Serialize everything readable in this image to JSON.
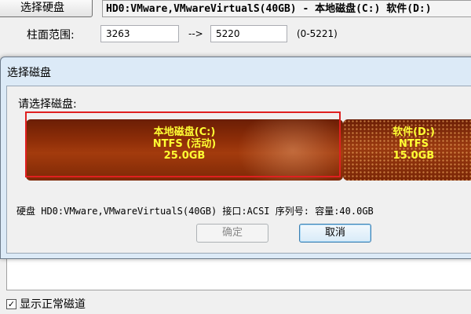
{
  "toolbar": {
    "select_disk_label": "选择硬盘",
    "disk_field_value": "HD0:VMware,VMwareVirtualS(40GB) - 本地磁盘(C:) 软件(D:)"
  },
  "cylinder": {
    "label": "柱面范围:",
    "from": "3263",
    "arrow": "-->",
    "to": "5220",
    "range": "(0-5221)"
  },
  "dialog": {
    "title": "选择磁盘",
    "prompt": "请选择磁盘:",
    "partitions": [
      {
        "name": "本地磁盘(C:)",
        "fs": "NTFS (活动)",
        "size": "25.0GB",
        "selected": true
      },
      {
        "name": "软件(D:)",
        "fs": "NTFS",
        "size": "15.0GB",
        "selected": false
      }
    ],
    "disk_info": "硬盘 HD0:VMware,VMwareVirtualS(40GB)   接口:ACSI  序列号:  容量:40.0GB",
    "ok_label": "确定",
    "cancel_label": "取消"
  },
  "options": {
    "show_normal_tracks_label": "显示正常磁道",
    "show_normal_tracks_checked": true
  },
  "colors": {
    "partition_text": "#ffff33",
    "partition_fill": "#8f2e08",
    "highlight": "#e02020"
  }
}
